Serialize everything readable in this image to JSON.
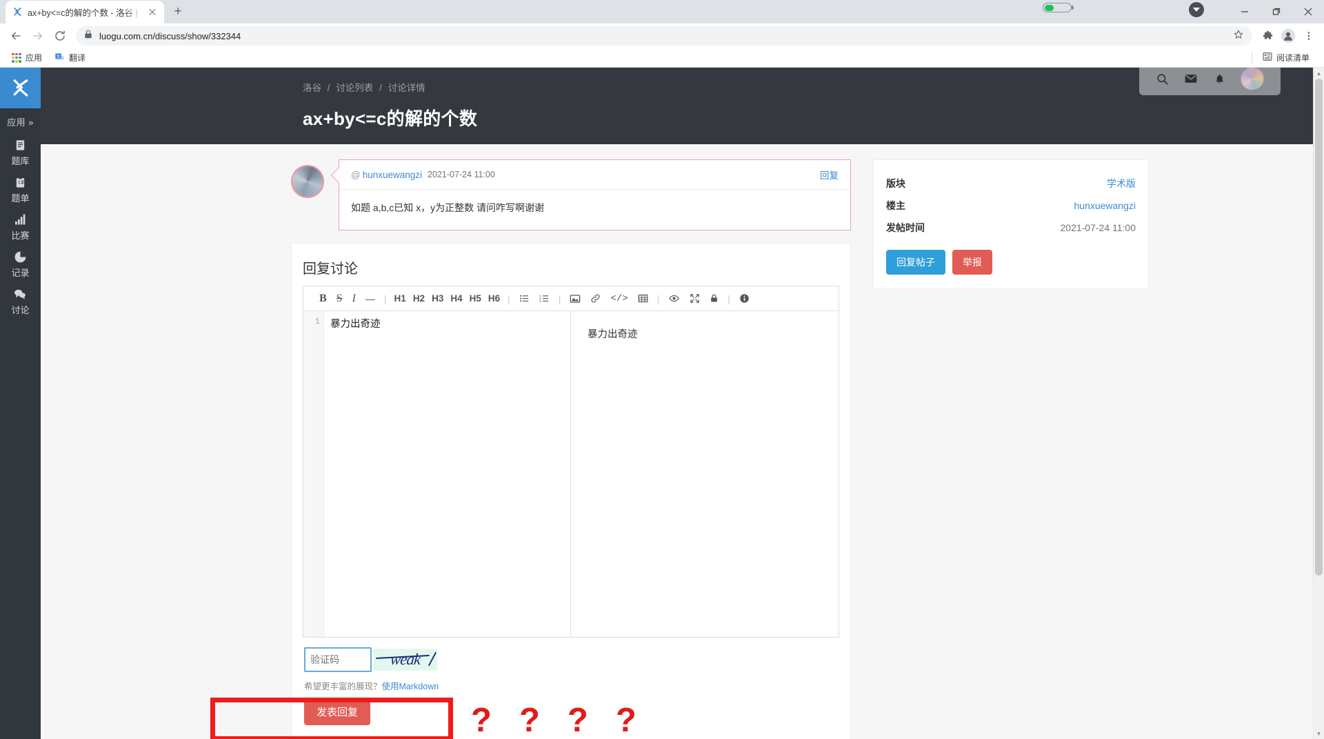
{
  "browser": {
    "tab": {
      "title": "ax+by<=c的解的个数 - 洛谷 | 计",
      "favicon": "luogu-logo-icon",
      "close_label": "×"
    },
    "new_tab_label": "+",
    "nav": {
      "back": "←",
      "forward": "→",
      "reload": "⟳"
    },
    "omnibox": {
      "url": "luogu.com.cn/discuss/show/332344",
      "lock_icon": "lock-icon",
      "star_icon": "star-icon"
    },
    "toolbar_icons": [
      "extensions-icon",
      "profile-icon",
      "more-menu-icon"
    ],
    "window_controls": {
      "minimize": "—",
      "maximize": "□",
      "close": "✕"
    },
    "bookmarks": [
      {
        "label": "应用",
        "icon": "apps-grid-icon"
      },
      {
        "label": "翻译",
        "icon": "translate-icon"
      }
    ],
    "bookmarks_right": {
      "label": "阅读清单",
      "icon": "reading-list-icon"
    },
    "battery": {
      "icon": "battery-icon",
      "level_color": "#18c457"
    },
    "download_icon": "download-icon"
  },
  "sidebar": {
    "logo": "luogu-logo",
    "apps_label": "应用 »",
    "items": [
      {
        "label": "题库",
        "icon": "book-icon"
      },
      {
        "label": "题单",
        "icon": "clipboard-icon"
      },
      {
        "label": "比赛",
        "icon": "bar-chart-icon"
      },
      {
        "label": "记录",
        "icon": "pie-chart-icon"
      },
      {
        "label": "讨论",
        "icon": "comments-icon"
      }
    ]
  },
  "header": {
    "breadcrumb": [
      "洛谷",
      "讨论列表",
      "讨论详情"
    ],
    "title": "ax+by<=c的解的个数",
    "actions": [
      "search-icon",
      "mail-icon",
      "bell-icon",
      "avatar"
    ]
  },
  "post": {
    "at_symbol": "@",
    "author": "hunxuewangzi",
    "time": "2021-07-24 11:00",
    "reply_label": "回复",
    "body": "如题 a,b,c已知 x，y为正整数 请问咋写啊谢谢"
  },
  "reply_panel": {
    "title": "回复讨论",
    "toolbar": {
      "bold": "B",
      "strike": "S",
      "italic": "I",
      "hr": "—",
      "headings": [
        "H1",
        "H2",
        "H3",
        "H4",
        "H5",
        "H6"
      ],
      "ul": "unordered-list-icon",
      "ol": "ordered-list-icon",
      "image": "image-icon",
      "link": "link-icon",
      "code": "code-icon",
      "table": "table-icon",
      "preview": "eye-icon",
      "fullscreen": "expand-icon",
      "lock": "lock-icon",
      "info": "info-icon",
      "separator": "|"
    },
    "editor": {
      "line_number": "1",
      "text": "暴力出奇迹"
    },
    "preview": {
      "text": "暴力出奇迹"
    },
    "captcha": {
      "placeholder": "验证码",
      "value": "",
      "image_text": "weak"
    },
    "markdown_hint": {
      "prefix": "希望更丰富的展现？",
      "link": "使用Markdown"
    },
    "submit_label": "发表回复"
  },
  "annotations": {
    "question_marks": [
      "?",
      "?",
      "?",
      "?"
    ],
    "highlight_box_color": "#ef1c1c"
  },
  "side_panel": {
    "rows": [
      {
        "key": "版块",
        "value": "学术版",
        "is_link": true
      },
      {
        "key": "楼主",
        "value": "hunxuewangzi",
        "is_link": true
      },
      {
        "key": "发帖时间",
        "value": "2021-07-24 11:00",
        "is_link": false
      }
    ],
    "reply_post_label": "回复帖子",
    "report_label": "举报"
  }
}
